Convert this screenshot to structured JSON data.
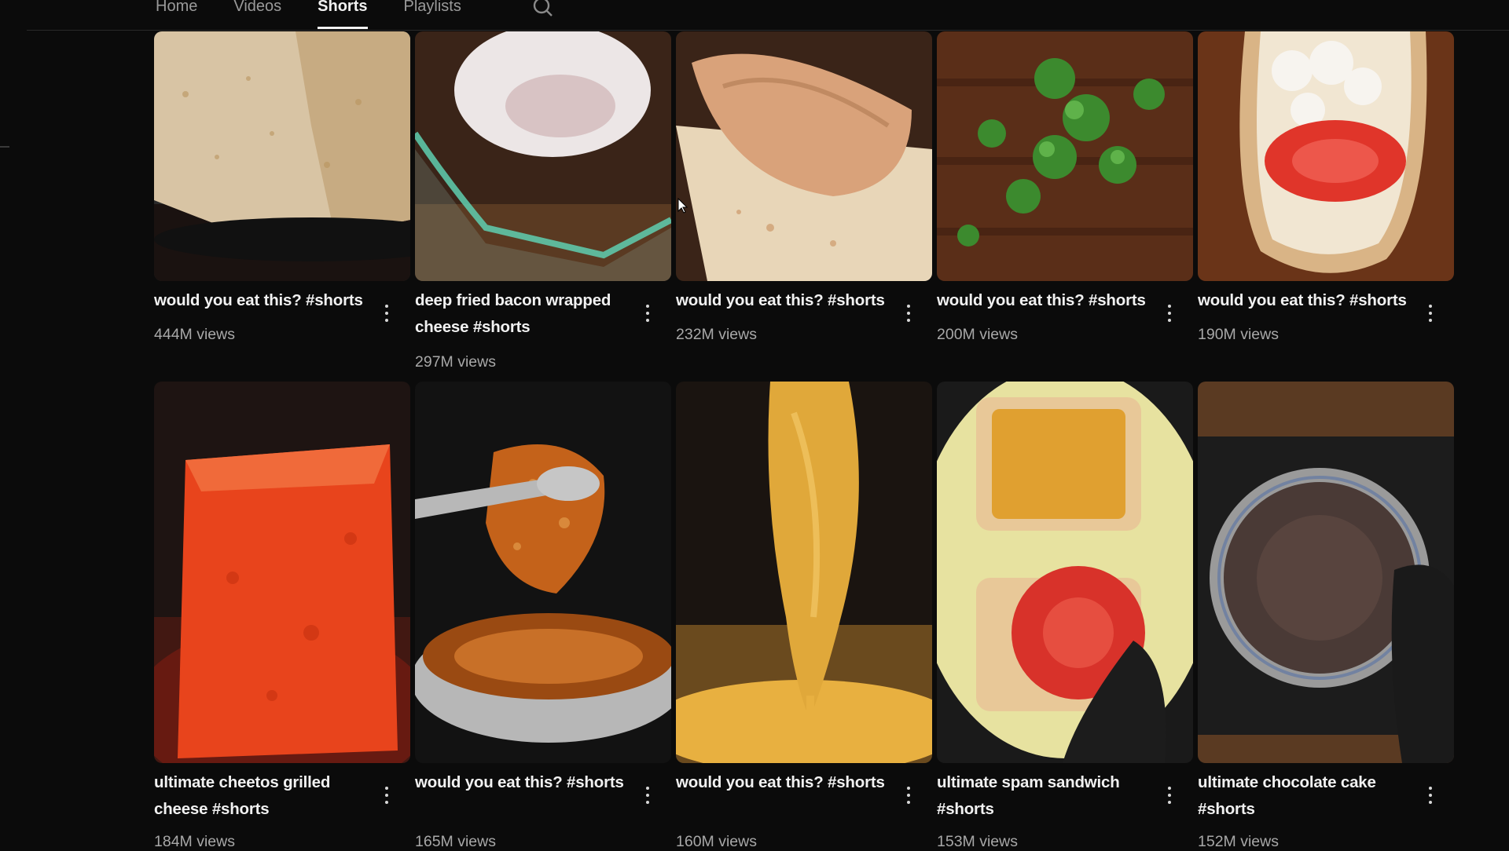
{
  "tabs": [
    {
      "label": "Home",
      "active": false
    },
    {
      "label": "Videos",
      "active": false
    },
    {
      "label": "Shorts",
      "active": true
    },
    {
      "label": "Playlists",
      "active": false
    }
  ],
  "search_icon": "search-icon",
  "videos": [
    {
      "title": "would you eat this? #shorts",
      "views": "444M views",
      "thumb": "crumb-cake"
    },
    {
      "title": "deep fried bacon wrapped cheese #shorts",
      "views": "297M views",
      "thumb": "glass-dish"
    },
    {
      "title": "would you eat this? #shorts",
      "views": "232M views",
      "thumb": "breaded-chicken"
    },
    {
      "title": "would you eat this? #shorts",
      "views": "200M views",
      "thumb": "parsley-board"
    },
    {
      "title": "would you eat this? #shorts",
      "views": "190M views",
      "thumb": "bread-tomato"
    },
    {
      "title": "ultimate cheetos grilled cheese #shorts",
      "views": "184M views",
      "thumb": "cheetos-block"
    },
    {
      "title": "would you eat this? #shorts",
      "views": "165M views",
      "thumb": "fried-tongs"
    },
    {
      "title": "would you eat this? #shorts",
      "views": "160M views",
      "thumb": "cheese-dip"
    },
    {
      "title": "ultimate spam sandwich #shorts",
      "views": "153M views",
      "thumb": "spam-egg"
    },
    {
      "title": "ultimate chocolate cake #shorts",
      "views": "152M views",
      "thumb": "chocolate-pot"
    }
  ],
  "colors": {
    "background": "#0b0b0b",
    "text": "#f1f1f1",
    "muted": "#a8a8a8"
  }
}
